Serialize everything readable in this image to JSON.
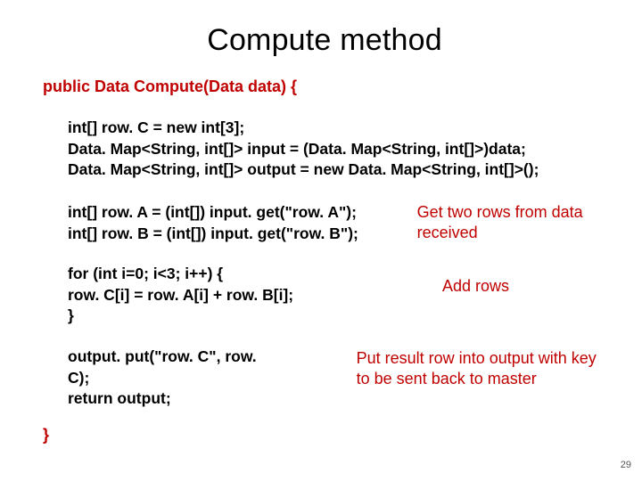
{
  "title": "Compute method",
  "signature": "public Data Compute(Data data) {",
  "block1": {
    "l1": "int[] row. C = new int[3];",
    "l2": "Data. Map<String, int[]> input = (Data. Map<String, int[]>)data;",
    "l3": "Data. Map<String, int[]> output = new Data. Map<String, int[]>();"
  },
  "block2": {
    "l1": "int[] row. A = (int[]) input. get(\"row. A\");",
    "l2": "int[] row. B = (int[]) input. get(\"row. B\");",
    "note": "Get two rows from data received"
  },
  "block3": {
    "l1": "for (int i=0; i<3; i++) {",
    "l2": " row. C[i] = row. A[i] + row. B[i];",
    "l3": "}",
    "note": "Add rows"
  },
  "block4": {
    "l1": "output. put(\"row. C\", row. C);",
    "l2": "return output;",
    "note": "Put result row into output with key to be sent back to master"
  },
  "close": "}",
  "page": "29"
}
